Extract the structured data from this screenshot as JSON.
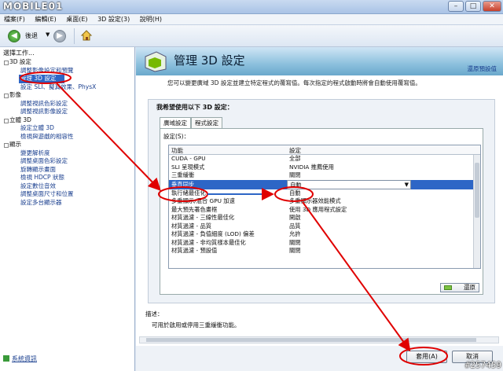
{
  "titlebar": {
    "logo": "MOBILE01"
  },
  "menu": {
    "items": [
      "檔案(F)",
      "編輯(E)",
      "桌面(E)",
      "3D 設定(3)",
      "說明(H)"
    ]
  },
  "toolbar": {
    "back_label": "後退"
  },
  "sidebar": {
    "header": "選擇工作...",
    "tree": [
      {
        "type": "cat",
        "label": "3D 設定"
      },
      {
        "type": "item",
        "label": "調整影像設定和預覽"
      },
      {
        "type": "item",
        "label": "管理 3D 設定",
        "selected": true
      },
      {
        "type": "item",
        "label": "設定 SLI、擬真效果、PhysX"
      },
      {
        "type": "cat",
        "label": "影像"
      },
      {
        "type": "item",
        "label": "調整視訊色彩設定"
      },
      {
        "type": "item",
        "label": "調整視訊影像設定"
      },
      {
        "type": "cat",
        "label": "立體 3D"
      },
      {
        "type": "item",
        "label": "設定立體 3D"
      },
      {
        "type": "item",
        "label": "檢視與遊戲的相容性"
      },
      {
        "type": "cat",
        "label": "顯示"
      },
      {
        "type": "item",
        "label": "變更解析度"
      },
      {
        "type": "item",
        "label": "調整桌面色彩設定"
      },
      {
        "type": "item",
        "label": "旋轉顯示畫面"
      },
      {
        "type": "item",
        "label": "檢視 HDCP 狀態"
      },
      {
        "type": "item",
        "label": "設定數位音效"
      },
      {
        "type": "item",
        "label": "調整桌面尺寸和位置"
      },
      {
        "type": "item",
        "label": "設定多台顯示器"
      }
    ],
    "footer_link": "系統資訊"
  },
  "main": {
    "title": "管理 3D 設定",
    "restore_link": "還原預設值",
    "subtitle": "您可以變更廣域 3D 設定並建立特定程式的覆寫值。每次指定的程式啟動時將會自動使用覆寫值。",
    "panel_heading": "我希望使用以下 3D 設定：",
    "tabs": [
      "廣域設定",
      "程式設定"
    ],
    "settings_label": "設定(S)：",
    "columns": [
      "功能",
      "設定"
    ],
    "rows": [
      [
        "CUDA - GPU",
        "全部"
      ],
      [
        "SLI 呈現模式",
        "NVIDIA 推薦使用"
      ],
      [
        "三重緩衝",
        "關閉"
      ],
      [
        "垂直同步",
        "自動"
      ],
      [
        "執行緒最佳化",
        "自動"
      ],
      [
        "多重顯示/混合 GPU 加速",
        "多重顯示器效能模式"
      ],
      [
        "最大預先著色畫框",
        "使用 3D 應用程式設定"
      ],
      [
        "材質過濾 - 三線性最佳化",
        "開啟"
      ],
      [
        "材質過濾 - 品質",
        "品質"
      ],
      [
        "材質過濾 - 負值細度 (LOD) 偏差",
        "允許"
      ],
      [
        "材質過濾 - 非均質樣本最佳化",
        "關閉"
      ],
      [
        "材質過濾 - 預設值",
        "關閉"
      ]
    ],
    "selected_row": 3,
    "restore_button": "還原",
    "description_label": "描述：",
    "description_text": "可用於啟用或停用三重緩衝功能。",
    "apply_button": "套用(A)",
    "cancel_button": "取消"
  },
  "watermark": "#257459",
  "colors": {
    "selection": "#2d66c6",
    "annotation": "#e00000"
  }
}
